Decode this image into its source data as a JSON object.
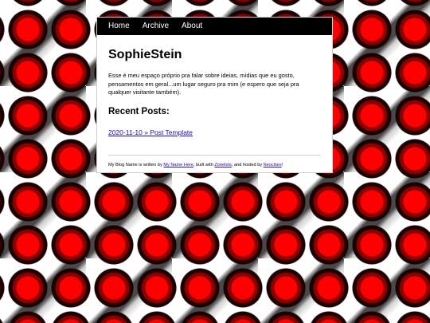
{
  "nav": {
    "items": [
      {
        "label": "Home"
      },
      {
        "label": "Archive"
      },
      {
        "label": "About"
      }
    ]
  },
  "site": {
    "title": "SophieStein",
    "intro": "Esse é meu espaço próprio pra falar sobre ideias, mídias que eu gosto, pensamentos em geral...um lugar seguro pra mim (e espero que seja pra qualquer visitante também)."
  },
  "recent": {
    "heading": "Recent Posts:",
    "posts": [
      {
        "label": "2020-11-10 » Post Template"
      }
    ]
  },
  "footer": {
    "prefix": "My Blog Name is written by ",
    "author_link": "My Name Here",
    "mid": ", built with ",
    "builder_link": "Zonelets",
    "mid2": ", and hosted by ",
    "host_link": "Neocities",
    "suffix": "!"
  },
  "colors": {
    "nav_bg": "#000000",
    "link": "#1a0dab",
    "background_accent": "#ff0000"
  }
}
